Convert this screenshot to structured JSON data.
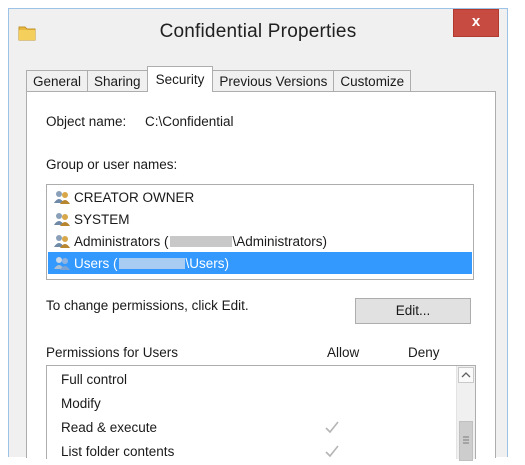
{
  "window": {
    "title": "Confidential Properties",
    "close_label": "x"
  },
  "tabs": [
    {
      "label": "General"
    },
    {
      "label": "Sharing"
    },
    {
      "label": "Security",
      "active": true
    },
    {
      "label": "Previous Versions"
    },
    {
      "label": "Customize"
    }
  ],
  "object": {
    "label": "Object name:",
    "value": "C:\\Confidential"
  },
  "groups": {
    "label": "Group or user names:",
    "items": [
      {
        "name": "CREATOR OWNER"
      },
      {
        "name": "SYSTEM"
      },
      {
        "prefix": "Administrators (",
        "suffix": "\\Administrators)"
      },
      {
        "prefix": "Users (",
        "suffix": "\\Users)",
        "selected": true
      }
    ]
  },
  "change_hint": "To change permissions, click Edit.",
  "edit_button": "Edit...",
  "permissions": {
    "title": "Permissions for Users",
    "allow_header": "Allow",
    "deny_header": "Deny",
    "rows": [
      {
        "name": "Full control",
        "allow": false,
        "deny": false
      },
      {
        "name": "Modify",
        "allow": false,
        "deny": false
      },
      {
        "name": "Read & execute",
        "allow": true,
        "deny": false
      },
      {
        "name": "List folder contents",
        "allow": true,
        "deny": false
      }
    ]
  },
  "colors": {
    "selection": "#3399ff",
    "close_button": "#c74b40",
    "disabled_check": "#b5b5b5"
  },
  "icons": [
    "folder-icon",
    "users-icon",
    "close-icon",
    "checkmark-icon",
    "scroll-up-icon"
  ]
}
